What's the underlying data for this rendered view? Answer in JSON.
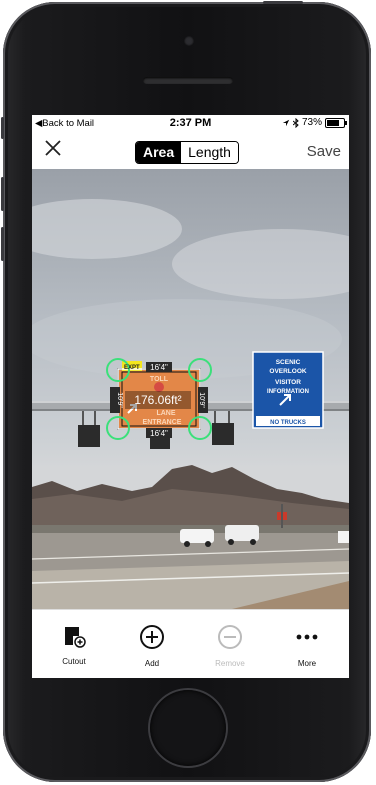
{
  "status_bar": {
    "back": "◀Back to Mail",
    "time": "2:37 PM",
    "battery": "73%",
    "battery_level": 0.73
  },
  "nav": {
    "close_icon": "close-icon",
    "segments": [
      {
        "label": "Area",
        "selected": true
      },
      {
        "label": "Length",
        "selected": false
      }
    ],
    "save": "Save"
  },
  "photo": {
    "measurement": "176.06ft²",
    "dims": {
      "top": "16'4\"",
      "bottom": "16'4\"",
      "left": "10'9\"",
      "right": "10'9\""
    },
    "toll_sign": {
      "tag": "EXPT",
      "line1": "TOLL",
      "line2": "LANE",
      "line3": "ENTRANCE"
    },
    "green_sign": {
      "line1": "SCENIC",
      "line2": "OVERLOOK",
      "line3": "VISITOR",
      "line4": "INFORMATION",
      "line5": "NO TRUCKS"
    }
  },
  "toolbar": [
    {
      "label": "Cutout",
      "icon": "cutout-icon",
      "enabled": true
    },
    {
      "label": "Add",
      "icon": "add-circle-icon",
      "enabled": true
    },
    {
      "label": "Remove",
      "icon": "remove-circle-icon",
      "enabled": false
    },
    {
      "label": "More",
      "icon": "more-icon",
      "enabled": true
    }
  ],
  "colors": {
    "handle": "#3be07a",
    "toll_sign": "#e0772f",
    "green_sign": "#1b55a8"
  }
}
